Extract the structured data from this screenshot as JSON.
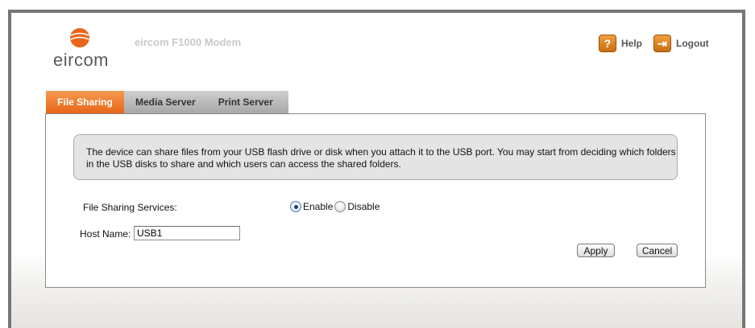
{
  "header": {
    "logo_text": "eircom",
    "app_title": "eircom F1000 Modem",
    "help_label": "Help",
    "logout_label": "Logout",
    "help_icon_glyph": "?",
    "logout_icon_glyph": "⇥"
  },
  "tabs": [
    {
      "label": "File Sharing",
      "active": true
    },
    {
      "label": "Media Server",
      "active": false
    },
    {
      "label": "Print Server",
      "active": false
    }
  ],
  "info_text": "The device can share files from your USB flash drive or disk when you attach it to the USB port. You may start from deciding which folders in the USB disks to share and which users can access the shared folders.",
  "file_sharing": {
    "label": "File Sharing Services:",
    "options": [
      "Enable",
      "Disable"
    ],
    "selected": "Enable"
  },
  "host": {
    "label": "Host Name:",
    "value": "USB1"
  },
  "buttons": {
    "apply": "Apply",
    "cancel": "Cancel"
  },
  "colors": {
    "accent_orange": "#e8661a",
    "logo_orange": "#e8661a",
    "frame_gray": "#767676"
  }
}
